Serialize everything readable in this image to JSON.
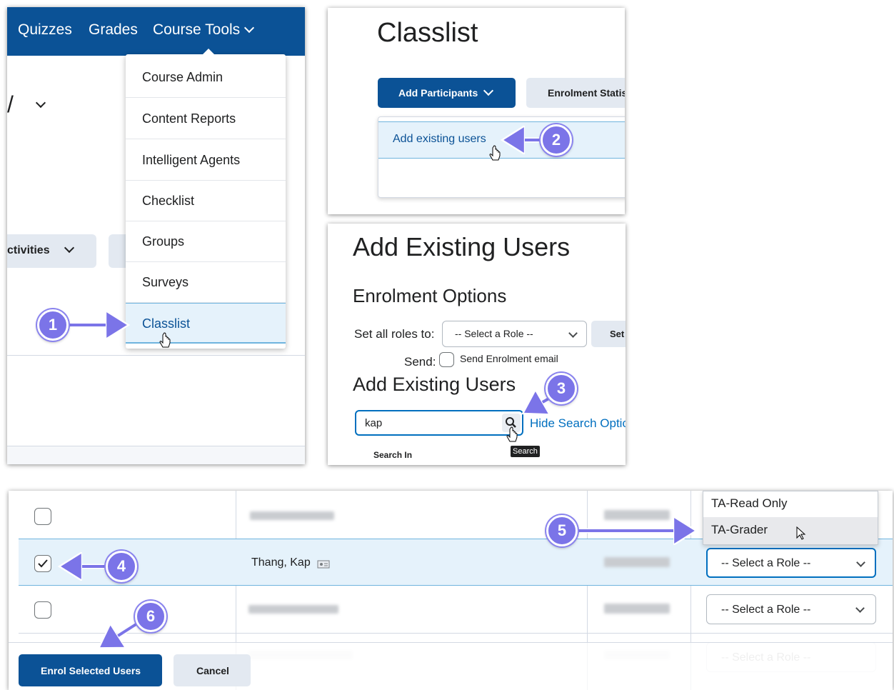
{
  "panel1": {
    "nav": {
      "quizzes": "Quizzes",
      "grades": "Grades",
      "course_tools": "Course Tools"
    },
    "partial_title": "/",
    "activities_label": "ctivities",
    "menu_items": [
      "Course Admin",
      "Content Reports",
      "Intelligent Agents",
      "Checklist",
      "Groups",
      "Surveys",
      "Classlist"
    ]
  },
  "panel2": {
    "title": "Classlist",
    "add_participants": "Add Participants",
    "enrolment_statistics": "Enrolment Statist",
    "add_existing_users": "Add existing users"
  },
  "panel3": {
    "title": "Add Existing Users",
    "enrolment_options": "Enrolment Options",
    "set_all_roles_label": "Set all roles to:",
    "select_role": "-- Select a Role --",
    "set_button": "Set",
    "send_label": "Send:",
    "send_email": "Send Enrolment email",
    "section_title": "Add Existing Users",
    "search_value": "kap",
    "hide_search": "Hide Search Optic",
    "search_tooltip": "Search",
    "search_in": "Search In"
  },
  "panel4": {
    "role_options": [
      "TA-Read Only",
      "TA-Grader"
    ],
    "user_name": "Thang, Kap",
    "select_role": "-- Select a Role --",
    "enrol_button": "Enrol Selected Users",
    "cancel_button": "Cancel"
  },
  "steps": [
    "1",
    "2",
    "3",
    "4",
    "5",
    "6"
  ],
  "colors": {
    "brand_blue": "#0b5296",
    "highlight": "#e5f2fb",
    "annotation": "#7b74e8"
  }
}
